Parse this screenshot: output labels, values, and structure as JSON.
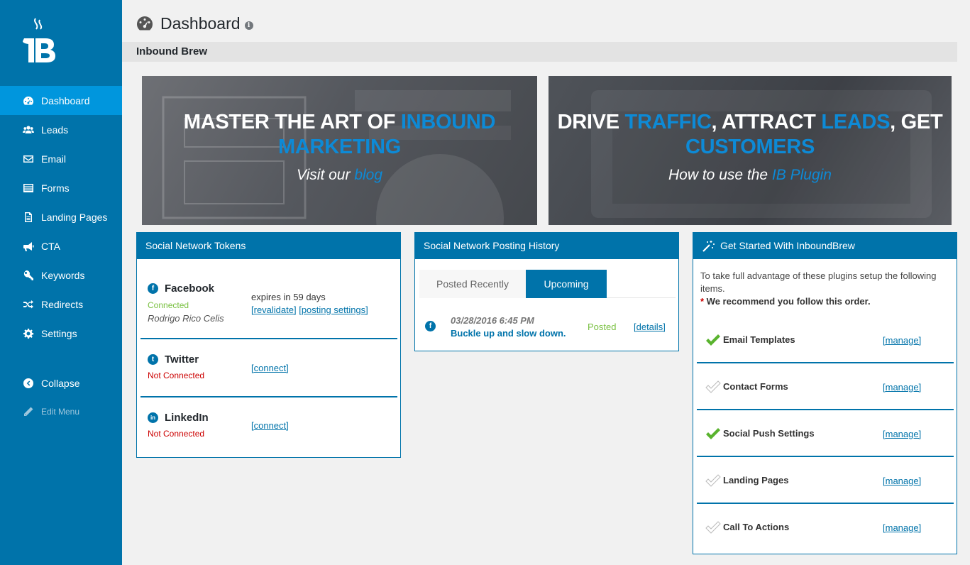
{
  "sidebar": {
    "items": [
      {
        "label": "Dashboard",
        "icon": "gauge-icon",
        "active": true
      },
      {
        "label": "Leads",
        "icon": "users-icon"
      },
      {
        "label": "Email",
        "icon": "envelope-icon"
      },
      {
        "label": "Forms",
        "icon": "form-list-icon"
      },
      {
        "label": "Landing Pages",
        "icon": "document-icon"
      },
      {
        "label": "CTA",
        "icon": "megaphone-icon"
      },
      {
        "label": "Keywords",
        "icon": "key-icon"
      },
      {
        "label": "Redirects",
        "icon": "shuffle-icon"
      },
      {
        "label": "Settings",
        "icon": "gear-icon"
      }
    ],
    "collapse_label": "Collapse",
    "edit_menu_label": "Edit Menu"
  },
  "header": {
    "title": "Dashboard",
    "info": "i",
    "section": "Inbound Brew"
  },
  "banners": {
    "left": {
      "line1_plain": "MASTER THE ART OF ",
      "line1_hl": "INBOUND",
      "line2_hl": "MARKETING",
      "sub_plain": "Visit our ",
      "sub_link": "blog"
    },
    "right": {
      "p1": "DRIVE ",
      "h1": "TRAFFIC",
      "p2": ", ATTRACT ",
      "h2": "LEADS",
      "p3": ", GET",
      "h3": "CUSTOMERS",
      "sub_plain": "How to use the ",
      "sub_link": "IB Plugin"
    }
  },
  "tokens": {
    "title": "Social Network Tokens",
    "facebook": {
      "name": "Facebook",
      "icon_letter": "f",
      "status": "Connected",
      "user": "Rodrigo Rico Celis",
      "expires": "expires in 59 days",
      "revalidate": "[revalidate]",
      "posting_settings": "[posting settings]"
    },
    "twitter": {
      "name": "Twitter",
      "icon_letter": "t",
      "status": "Not Connected",
      "connect": "[connect]"
    },
    "linkedin": {
      "name": "LinkedIn",
      "icon_letter": "in",
      "status": "Not Connected",
      "connect": "[connect]"
    }
  },
  "history": {
    "title": "Social Network Posting History",
    "tab_recent": "Posted Recently",
    "tab_upcoming": "Upcoming",
    "post": {
      "icon_letter": "f",
      "date": "03/28/2016 6:45 PM",
      "text": "Buckle up and slow down.",
      "status": "Posted",
      "details": "[details]"
    }
  },
  "get_started": {
    "title": "Get Started With InboundBrew",
    "intro": "To take full advantage of these plugins setup the following items.",
    "star": "*",
    "recommend": " We recommend you follow this order.",
    "items": [
      {
        "label": "Email Templates",
        "done": true,
        "manage": "[manage]"
      },
      {
        "label": "Contact Forms",
        "done": false,
        "manage": "[manage]"
      },
      {
        "label": "Social Push Settings",
        "done": true,
        "manage": "[manage]"
      },
      {
        "label": "Landing Pages",
        "done": false,
        "manage": "[manage]"
      },
      {
        "label": "Call To Actions",
        "done": false,
        "manage": "[manage]"
      }
    ]
  },
  "colors": {
    "sidebar": "#0073aa",
    "active": "#0096dd",
    "highlight": "#0d8ad6",
    "success": "#7ac142",
    "error": "#cc0000"
  }
}
